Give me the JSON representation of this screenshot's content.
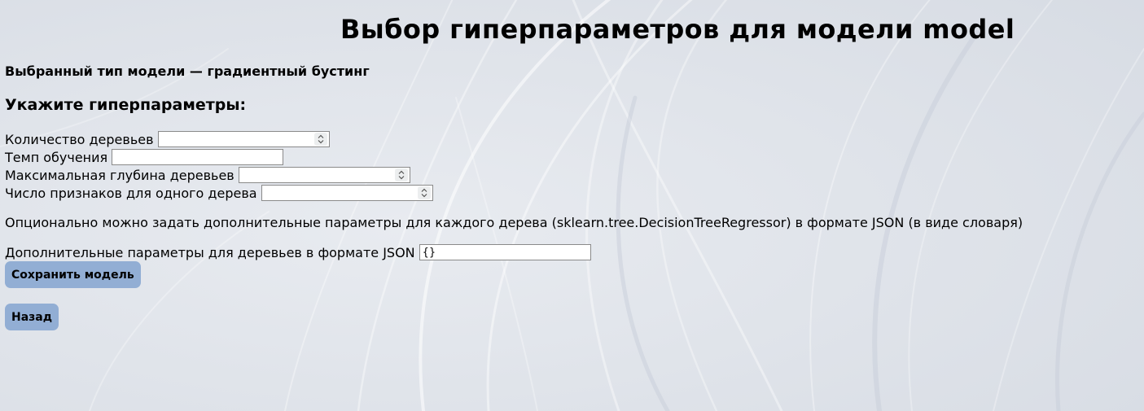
{
  "page": {
    "title": "Выбор гиперпараметров для модели model",
    "model_type": "Выбранный тип модели — градиентный бустинг",
    "subheading": "Укажите гиперпараметры:"
  },
  "form": {
    "n_estimators": {
      "label": "Количество деревьев",
      "value": ""
    },
    "learning_rate": {
      "label": "Темп обучения",
      "value": ""
    },
    "max_depth": {
      "label": "Максимальная глубина деревьев",
      "value": ""
    },
    "max_features": {
      "label": "Число признаков для одного дерева",
      "value": ""
    },
    "note": "Опционально можно задать дополнительные параметры для каждого дерева (sklearn.tree.DecisionTreeRegressor) в формате JSON (в виде словаря)",
    "tree_params": {
      "label": "Дополнительные параметры для деревьев в формате JSON",
      "value": "{}"
    }
  },
  "buttons": {
    "save": "Сохранить модель",
    "back": "Назад"
  },
  "icons": {
    "spinner": "up-down-chevron-icon"
  },
  "colors": {
    "background": "#dde2ea",
    "button": "#92aed4"
  }
}
